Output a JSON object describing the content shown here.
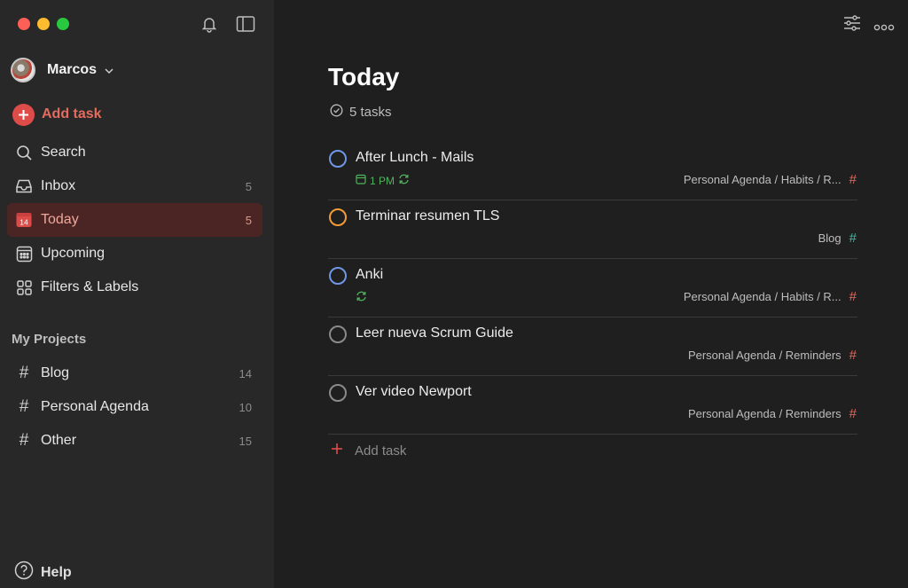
{
  "sidebar": {
    "user_name": "Marcos",
    "add_task_label": "Add task",
    "nav": [
      {
        "label": "Search",
        "count": "",
        "icon": "search-icon"
      },
      {
        "label": "Inbox",
        "count": "5",
        "icon": "inbox-icon"
      },
      {
        "label": "Today",
        "count": "5",
        "icon": "calendar-today-icon",
        "today_day": "14"
      },
      {
        "label": "Upcoming",
        "count": "",
        "icon": "calendar-grid-icon"
      },
      {
        "label": "Filters & Labels",
        "count": "",
        "icon": "grid-icon"
      }
    ],
    "projects_title": "My Projects",
    "projects": [
      {
        "name": "Blog",
        "count": "14",
        "color": "#4fb5a3"
      },
      {
        "name": "Personal Agenda",
        "count": "10",
        "color": "#e56a5c"
      },
      {
        "name": "Other",
        "count": "15",
        "color": "#e56a5c"
      }
    ],
    "help_label": "Help"
  },
  "main": {
    "title": "Today",
    "task_count": "5 tasks",
    "tasks": [
      {
        "title": "After Lunch - Mails",
        "time": "1 PM",
        "project": "Personal Agenda / Habits / R...",
        "check_color": "blue"
      },
      {
        "title": "Terminar resumen TLS",
        "time": "",
        "project": "Blog",
        "check_color": "orange"
      },
      {
        "title": "Anki",
        "time": "",
        "project": "Personal Agenda / Habits / R...",
        "check_color": "blue"
      },
      {
        "title": "Leer nueva Scrum Guide",
        "time": "",
        "project": "Personal Agenda / Reminders",
        "check_color": "gray"
      },
      {
        "title": "Ver video Newport",
        "time": "",
        "project": "Personal Agenda / Reminders",
        "check_color": "gray"
      }
    ],
    "add_task_label": "Add task"
  },
  "colors": {
    "accent": "#de4c4a",
    "today_bg": "#4a2523",
    "priority_blue": "#6f97e5",
    "priority_orange": "#f29c38",
    "recurring_green": "#4fb35b"
  }
}
